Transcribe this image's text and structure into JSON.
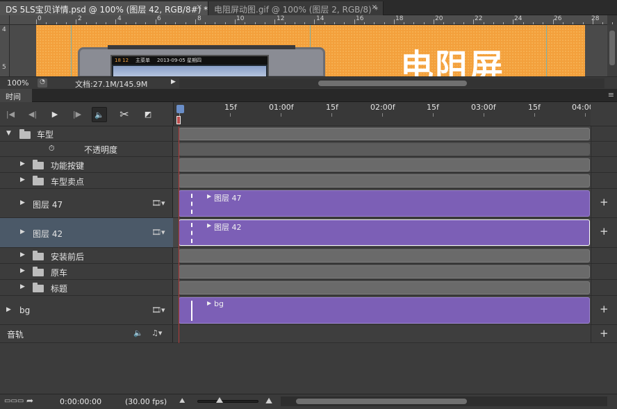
{
  "tabs": [
    {
      "title": "DS 5LS宝贝详情.psd @ 100% (图层 42, RGB/8#) *",
      "close": "×"
    },
    {
      "title": "电阻屏动图.gif @ 100% (图层 2, RGB/8) *",
      "close": "×"
    }
  ],
  "ruler": {
    "h_labels": [
      "0",
      "2",
      "4",
      "6",
      "8",
      "10",
      "12",
      "14",
      "16",
      "18",
      "20",
      "22",
      "24",
      "26",
      "28"
    ],
    "v_labels": [
      "4",
      "5"
    ]
  },
  "canvas": {
    "headline": "电阻屏",
    "screen_time": "18 12",
    "screen_menu": "主菜单",
    "screen_date": "2013-09-05 星期四"
  },
  "doc_status": {
    "zoom": "100%",
    "doc_size": "文档:27.1M/145.9M"
  },
  "timeline": {
    "panel_title": "时间轴",
    "time_labels": [
      "15f",
      "01:00f",
      "15f",
      "02:00f",
      "15f",
      "03:00f",
      "15f",
      "04:00"
    ],
    "tracks": [
      {
        "name": "车型",
        "kind": "group-open",
        "label": "车型"
      },
      {
        "name": "opacity",
        "kind": "property",
        "label": "不透明度"
      },
      {
        "name": "功能按键",
        "kind": "group",
        "label": "功能按键"
      },
      {
        "name": "车型卖点",
        "kind": "group",
        "label": "车型卖点"
      },
      {
        "name": "图层 47",
        "kind": "layer",
        "label": "图层 47",
        "clip": "图层 47"
      },
      {
        "name": "图层 42",
        "kind": "layer",
        "label": "图层 42",
        "clip": "图层 42"
      },
      {
        "name": "安装前后",
        "kind": "group",
        "label": "安装前后"
      },
      {
        "name": "原车",
        "kind": "group",
        "label": "原车"
      },
      {
        "name": "标题",
        "kind": "group",
        "label": "标题"
      },
      {
        "name": "bg",
        "kind": "layer",
        "label": "bg",
        "clip": "bg"
      },
      {
        "name": "音轨",
        "kind": "audio",
        "label": "音轨"
      }
    ],
    "film_icon": "🎞",
    "plus": "+",
    "timecode": "0:00:00:00",
    "fps": "(30.00 fps)"
  },
  "colors": {
    "canvas_orange": "#f3a03c",
    "clip_purple": "#7c5fb6",
    "selected_row": "#4b5968",
    "playhead_line": "#b33a3a"
  }
}
